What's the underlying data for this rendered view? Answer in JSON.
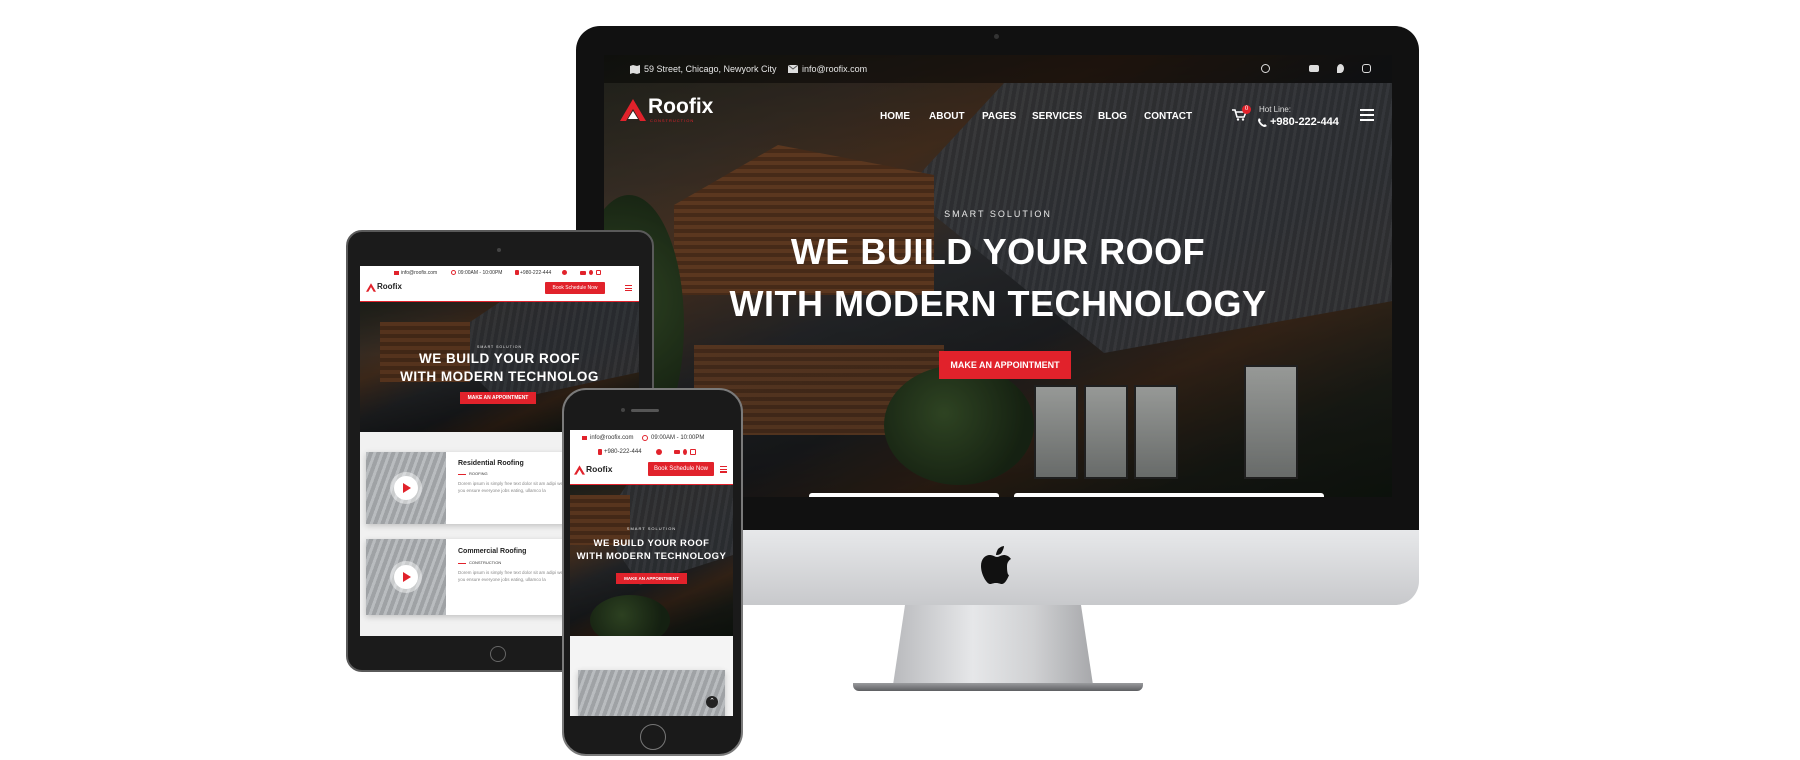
{
  "brand": {
    "name": "Roofix",
    "tagline": "CONSTRUCTION",
    "accent": "#e1222b"
  },
  "desktop": {
    "topbar": {
      "address": "59 Street, Chicago, Newyork City",
      "email": "info@roofix.com"
    },
    "nav": [
      "HOME",
      "ABOUT",
      "PAGES",
      "SERVICES",
      "BLOG",
      "CONTACT"
    ],
    "cart_count": "0",
    "hotline_label": "Hot Line:",
    "hotline_number": "+980-222-444",
    "hero": {
      "eyebrow": "SMART SOLUTION",
      "title_line1": "WE BUILD YOUR ROOF",
      "title_line2": "WITH MODERN TECHNOLOGY",
      "cta": "MAKE AN APPOINTMENT"
    }
  },
  "tablet": {
    "topbar": {
      "email": "info@roofix.com",
      "hours": "09:00AM - 10:00PM",
      "phone": "+980-222-444"
    },
    "book_button": "Book Schedule Now",
    "hero": {
      "eyebrow": "SMART SOLUTION",
      "title_line1": "WE BUILD YOUR ROOF",
      "title_line2": "WITH MODERN TECHNOLOG",
      "cta": "MAKE AN APPOINTMENT"
    },
    "cards": [
      {
        "title": "Residential Roofing",
        "tag": "ROOFING",
        "text": "Dorem ipsum is simply free text dolor sit am adipi we help you ensure everyone jobs eating, ullamco la"
      },
      {
        "title": "Commercial Roofing",
        "tag": "CONSTRUCTION",
        "text": "Dorem ipsum is simply free text dolor sit am adipi we help you ensure everyone jobs eating, ullamco la"
      }
    ]
  },
  "mobile": {
    "topbar": {
      "email": "info@roofix.com",
      "hours": "09:00AM - 10:00PM",
      "phone": "+980-222-444"
    },
    "book_button": "Book Schedule Now",
    "hero": {
      "eyebrow": "SMART SOLUTION",
      "title_line1": "WE BUILD YOUR ROOF",
      "title_line2": "WITH MODERN TECHNOLOGY",
      "cta": "MAKE AN APPOINTMENT"
    }
  },
  "icons": [
    "map-icon",
    "envelope-icon",
    "facebook-icon",
    "youtube-icon",
    "pinterest-icon",
    "instagram-icon",
    "cart-icon",
    "phone-icon",
    "menu-icon",
    "clock-icon",
    "play-icon",
    "scroll-top-icon",
    "apple-logo-icon"
  ]
}
